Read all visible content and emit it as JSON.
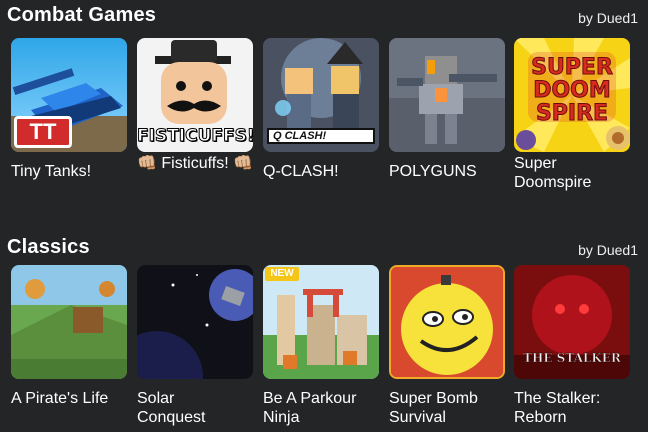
{
  "sections": [
    {
      "title": "Combat Games",
      "by": "by Dued1",
      "games": [
        {
          "name": "Tiny Tanks!",
          "thumb_text": "TT"
        },
        {
          "name": "👊🏼 Fisticuffs! 👊🏼",
          "thumb_text": "FISTICUFFS!"
        },
        {
          "name": "Q-CLASH!",
          "thumb_text": "Q CLASH!"
        },
        {
          "name": "POLYGUNS",
          "thumb_text": ""
        },
        {
          "name": "Super Doomspire",
          "thumb_text": "SUPER DOOM SPIRE"
        }
      ]
    },
    {
      "title": "Classics",
      "by": "by Dued1",
      "games": [
        {
          "name": "A Pirate's Life",
          "thumb_text": ""
        },
        {
          "name": "Solar Conquest",
          "thumb_text": ""
        },
        {
          "name": "Be A Parkour Ninja",
          "thumb_text": "NEW"
        },
        {
          "name": "Super Bomb Survival",
          "thumb_text": ""
        },
        {
          "name": "The Stalker: Reborn",
          "thumb_text": "THE STALKER"
        }
      ]
    }
  ],
  "colors": {
    "background": "#232527",
    "text": "#ffffff"
  }
}
